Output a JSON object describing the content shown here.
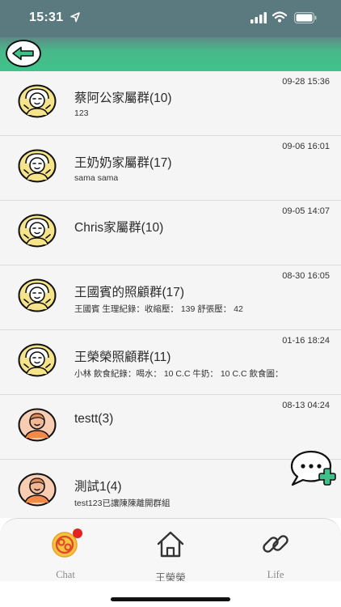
{
  "status_bar": {
    "time": "15:31"
  },
  "header": {
    "back_icon": "back-arrow-icon"
  },
  "chats": [
    {
      "name": "蔡阿公家屬群(10)",
      "preview": "123",
      "time": "09-28 15:36",
      "avatar": "elder-avatar-icon"
    },
    {
      "name": "王奶奶家屬群(17)",
      "preview": "sama sama",
      "time": "09-06 16:01",
      "avatar": "elder-avatar-icon"
    },
    {
      "name": "Chris家屬群(10)",
      "preview": "",
      "time": "09-05 14:07",
      "avatar": "elder-avatar-icon"
    },
    {
      "name": "王國賓的照顧群(17)",
      "preview": "王國賓 生理紀錄：收縮壓： 139 舒張壓： 42",
      "time": "08-30 16:05",
      "avatar": "elder-avatar-icon"
    },
    {
      "name": "王榮榮照顧群(11)",
      "preview": "小林 飲食紀錄：喝水： 10 C.C 牛奶： 10 C.C 飲食圖：",
      "time": "01-16 18:24",
      "avatar": "elder-avatar-icon"
    },
    {
      "name": "testt(3)",
      "preview": "",
      "time": "08-13 04:24",
      "avatar": "person-avatar-icon"
    },
    {
      "name": "測試1(4)",
      "preview": "test123已讓陳陳離開群組",
      "time": "01-",
      "avatar": "person-avatar-icon"
    }
  ],
  "fab": {
    "icon": "new-chat-icon"
  },
  "tabs": [
    {
      "label": "Chat",
      "icon": "chat-logo-icon",
      "has_badge": true
    },
    {
      "label": "王榮榮",
      "icon": "home-icon",
      "has_badge": false
    },
    {
      "label": "Life",
      "icon": "link-icon",
      "has_badge": false
    }
  ],
  "colors": {
    "status_bar": "#5b7a7f",
    "header_green": "#3fc38c",
    "back_arrow": "#3fbf8a",
    "badge": "#e52222",
    "avatar_yellow": "#f6e48a",
    "avatar_peach": "#f8cdb2",
    "fab_plus": "#3fbf8a"
  }
}
